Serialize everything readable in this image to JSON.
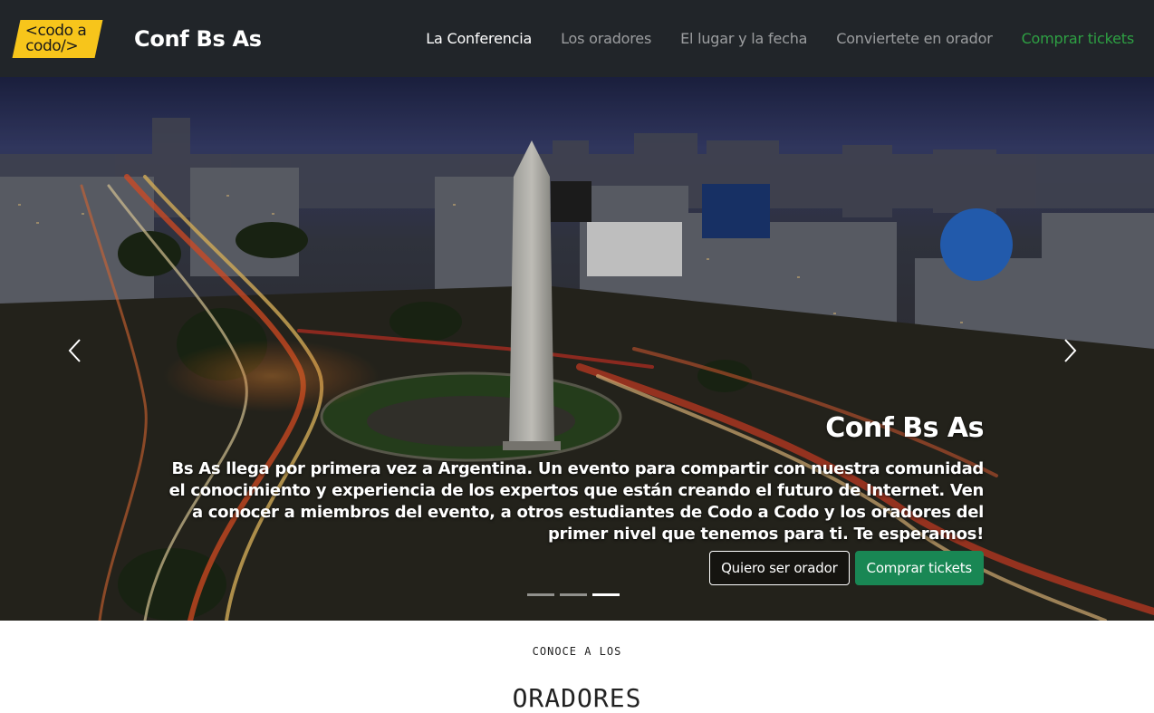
{
  "navbar": {
    "logo": {
      "line1": "<codo a",
      "line2": "codo/>",
      "color": "#f7c51b"
    },
    "title": "Conf Bs As",
    "links": [
      {
        "label": "La Conferencia",
        "active": true
      },
      {
        "label": "Los oradores"
      },
      {
        "label": "El lugar y la fecha"
      },
      {
        "label": "Conviertete en orador"
      },
      {
        "label": "Comprar tickets",
        "color": "#2ea043"
      }
    ]
  },
  "hero": {
    "caption_title": "Conf Bs As",
    "caption_text": "Bs As llega por primera vez a Argentina. Un evento para compartir con nuestra comunidad el conocimiento y experiencia de los expertos que están creando el futuro de Internet. Ven a conocer a miembros del evento, a otros estudiantes de Codo a Codo y los oradores del primer nivel que tenemos para ti. Te esperamos!",
    "buttons": {
      "speaker": "Quiero ser orador",
      "tickets": "Comprar tickets"
    },
    "slides": 3,
    "active_slide": 3,
    "button_green": "#198754"
  },
  "speakers": {
    "pre_title": "CONOCE A LOS",
    "title": "ORADORES"
  }
}
